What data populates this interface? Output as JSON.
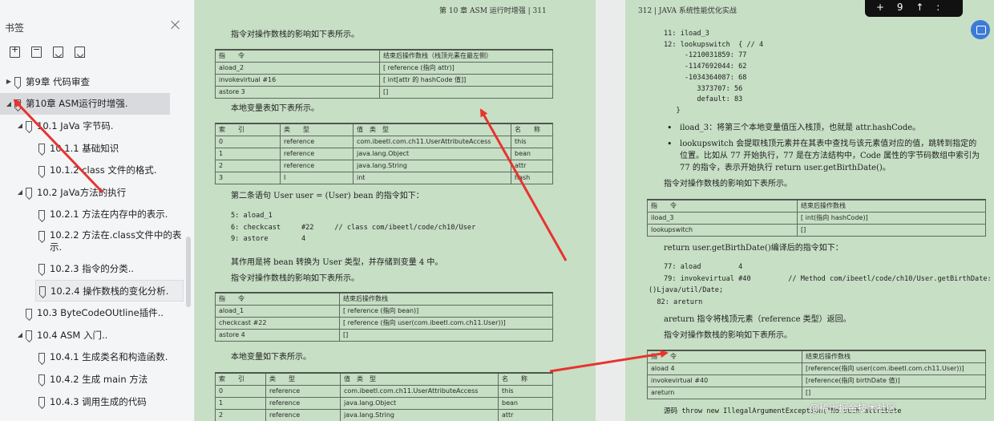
{
  "sidebar": {
    "title": "书签",
    "items": [
      {
        "label": "第9章 代码审查",
        "level": 0,
        "toggle": "▶"
      },
      {
        "label": "第10章 ASM运行时增强.",
        "level": 0,
        "toggle": "◢"
      },
      {
        "label": "10.1 JaVa 字节码.",
        "level": 1,
        "toggle": "◢"
      },
      {
        "label": "10.1.1 基础知识",
        "level": 2,
        "toggle": ""
      },
      {
        "label": "10.1.2 class 文件的格式.",
        "level": 2,
        "toggle": ""
      },
      {
        "label": "10.2 JaVa方法的执行",
        "level": 1,
        "toggle": "◢"
      },
      {
        "label": "10.2.1 方法在内存中的表示.",
        "level": 2,
        "toggle": ""
      },
      {
        "label": "10.2.2 方法在.class文件中的表示.",
        "level": 2,
        "toggle": ""
      },
      {
        "label": "10.2.3 指令的分类..",
        "level": 2,
        "toggle": ""
      },
      {
        "label": "10.2.4 操作数栈的变化分析.",
        "level": 2,
        "toggle": ""
      },
      {
        "label": "10.3 ByteCodeOUtline插件..",
        "level": 1,
        "toggle": ""
      },
      {
        "label": "10.4 ASM 入门..",
        "level": 1,
        "toggle": "◢"
      },
      {
        "label": "10.4.1 生成类名和构造函数.",
        "level": 2,
        "toggle": ""
      },
      {
        "label": "10.4.2 生成 main 方法",
        "level": 2,
        "toggle": ""
      },
      {
        "label": "10.4.3 调用生成的代码",
        "level": 2,
        "toggle": ""
      }
    ]
  },
  "left_page": {
    "running_head": "第 10 章   ASM 运行时增强   |   311",
    "p1": "指令对操作数栈的影响如下表所示。",
    "table1": {
      "headers": [
        "指　　令",
        "结束后操作数栈（栈顶元素在最左侧）"
      ],
      "rows": [
        [
          "aload_2",
          "[ reference (指向 attr)]"
        ],
        [
          "invokevirtual #16",
          "[ int[attr 的 hashCode 值]]"
        ],
        [
          "astore 3",
          "[]"
        ]
      ]
    },
    "p2": "本地变量表如下表所示。",
    "table2": {
      "headers": [
        "索　　引",
        "类　　型",
        "值　类　型",
        "名　　称"
      ],
      "rows": [
        [
          "0",
          "reference",
          "com.ibeetl.com.ch11.UserAttributeAccess",
          "this"
        ],
        [
          "1",
          "reference",
          "java.lang.Object",
          "bean"
        ],
        [
          "2",
          "reference",
          "java.lang.String",
          "attr"
        ],
        [
          "3",
          "I",
          "int",
          "hash"
        ]
      ]
    },
    "p3": "第二条语句 User user = (User) bean 的指令如下：",
    "code1": "5: aload_1\n6: checkcast     #22     // class com/ibeetl/code/ch10/User\n9: astore        4",
    "p4": "其作用是将 bean 转换为 User 类型，并存储到变量 4 中。",
    "p5": "指令对操作数栈的影响如下表所示。",
    "table3": {
      "headers": [
        "指　　令",
        "结束后操作数栈"
      ],
      "rows": [
        [
          "aload_1",
          "[ reference (指向 bean)]"
        ],
        [
          "checkcast #22",
          "[ reference (指向 user(com.ibeetl.com.ch11.User))]"
        ],
        [
          "astore 4",
          "[]"
        ]
      ]
    },
    "p6": "本地变量如下表所示。",
    "table4": {
      "headers": [
        "索　　引",
        "类　　型",
        "值　类　型",
        "名　　称"
      ],
      "rows": [
        [
          "0",
          "reference",
          "com.ibeetl.com.ch11.UserAttributeAccess",
          "this"
        ],
        [
          "1",
          "reference",
          "java.lang.Object",
          "bean"
        ],
        [
          "2",
          "reference",
          "java.lang.String",
          "attr"
        ]
      ]
    }
  },
  "right_page": {
    "running_head": "312   |   JAVA 系统性能优化实战",
    "code1": "11: iload_3\n12: lookupswitch  { // 4\n     -1210031859: 77\n     -1147692044: 62\n     -1034364087: 68\n        3373707: 56\n        default: 83\n   }",
    "bullet1": "iload_3：将第三个本地变量值压入栈顶，也就是 attr.hashCode。",
    "bullet2": "lookupswitch 会提取栈顶元素并在其表中查找与该元素值对应的值，跳转到指定的位置。比如从 77 开始执行，77 是在方法结构中，Code 属性的字节码数组中索引为 77 的指令，表示开始执行 return user.getBirthDate()。",
    "p1": "指令对操作数栈的影响如下表所示。",
    "table1": {
      "headers": [
        "指　　令",
        "结束后操作数栈"
      ],
      "rows": [
        [
          "iload_3",
          "[ int(指向 hashCode)]"
        ],
        [
          "lookupswitch",
          "[]"
        ]
      ]
    },
    "p2": "return user.getBirthDate()编译后的指令如下：",
    "code2": "77: aload         4\n79: invokevirtual #40         // Method com/ibeetl/code/ch10/User.getBirthDate:",
    "code3": "()Ljava/util/Date;\n  82: areturn",
    "p3": "areturn 指令将栈顶元素（reference 类型）返回。",
    "p4": "指令对操作数栈的影响如下表所示。",
    "table2": {
      "headers": [
        "指　　令",
        "结束后操作数栈"
      ],
      "rows": [
        [
          "aload 4",
          "[reference(指向 user(com.ibeetl.com.ch11.User))]"
        ],
        [
          "invokevirtual #40",
          "[reference(指向 birthDate 值)]"
        ],
        [
          "areturn",
          "[]"
        ]
      ]
    },
    "p5": "源码 throw new IllegalArgumentException(\"No such attribute"
  },
  "overlays": {
    "watermark": "@稀土掘金技术社区",
    "topbar_text": "+ 9 ↑ :"
  }
}
